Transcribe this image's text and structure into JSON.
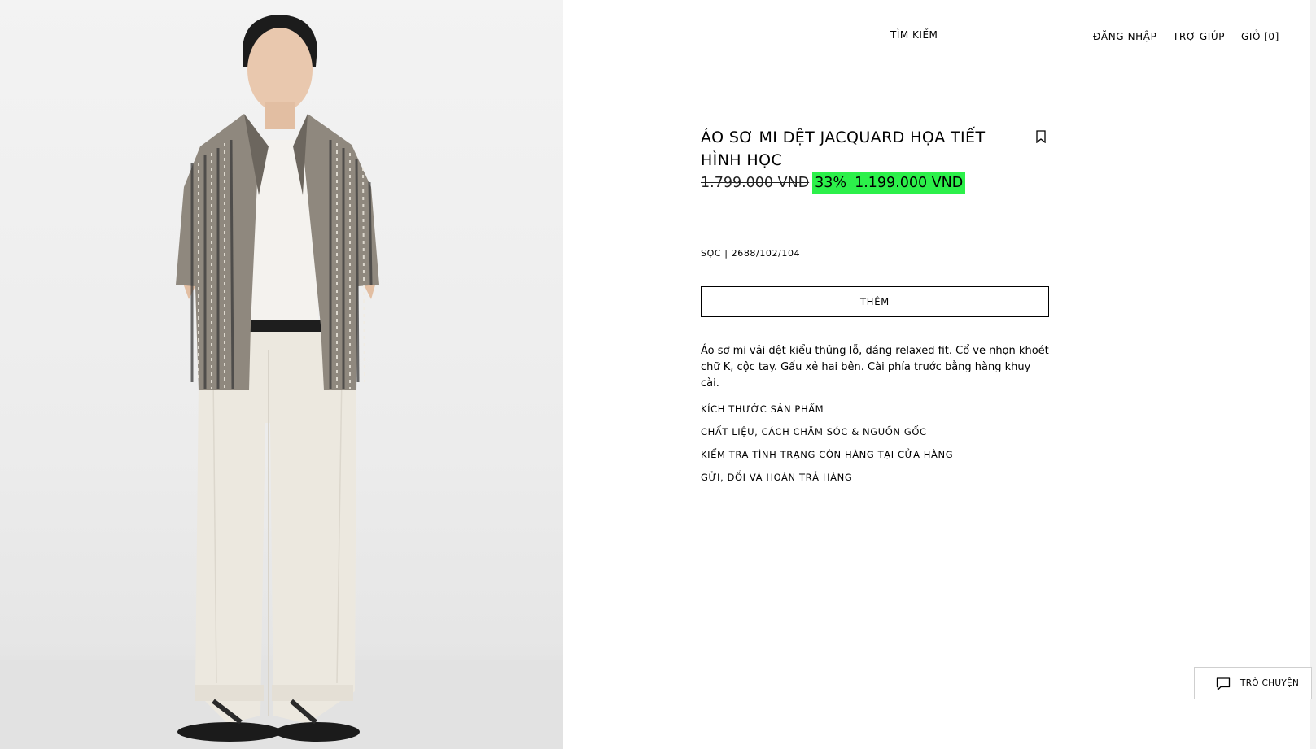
{
  "header": {
    "search_label": "TÌM KIẾM",
    "login": "ĐĂNG NHẬP",
    "help": "TRỢ GIÚP",
    "cart_label": "GIỎ",
    "cart_count": "[0]"
  },
  "product": {
    "image_alt": "Áo sơ mi dệt jacquard họa tiết hình học",
    "title": "ÁO SƠ MI DỆT JACQUARD HỌA TIẾT HÌNH HỌC",
    "old_price": "1.799.000 VND",
    "discount": "33%",
    "price": "1.199.000 VND",
    "color_ref": "SỌC | 2688/102/104",
    "add_button": "THÊM",
    "description": "Áo sơ mi vải dệt kiểu thủng lỗ, dáng relaxed fit. Cổ ve nhọn khoét chữ K, cộc tay. Gấu xẻ hai bên. Cài phía trước bằng hàng khuy cài.",
    "info_links": [
      "KÍCH THƯỚC SẢN PHẨM",
      "CHẤT LIỆU, CÁCH CHĂM SÓC & NGUỒN GỐC",
      "KIỂM TRA TÌNH TRẠNG CÒN HÀNG TẠI CỬA HÀNG",
      "GỬI, ĐỔI VÀ HOÀN TRẢ HÀNG"
    ]
  },
  "chat": {
    "label": "TRÒ CHUYỆN",
    "icon": "chat-bubble-icon"
  },
  "colors": {
    "sale_highlight": "#2cf04a",
    "text": "#000000",
    "background": "#ffffff"
  }
}
